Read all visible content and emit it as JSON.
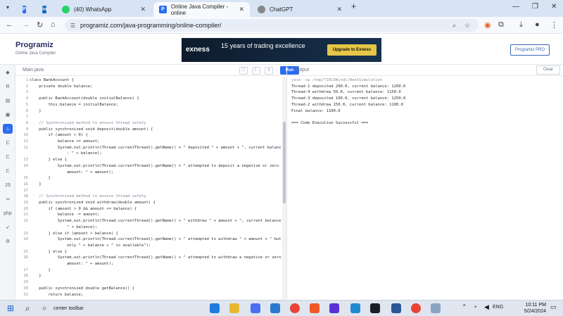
{
  "browser": {
    "tabs": [
      {
        "label": "",
        "icon": "programiz",
        "color": "#2b6cf0"
      },
      {
        "label": "",
        "icon": "linkedin",
        "color": "#0a66c2"
      },
      {
        "label": "(40) WhatsApp",
        "icon": "whatsapp",
        "color": "#25d366"
      },
      {
        "label": "Online Java Compiler - online",
        "icon": "programiz",
        "color": "#2b6cf0"
      },
      {
        "label": "ChatGPT",
        "icon": "chatgpt",
        "color": "#888888"
      }
    ],
    "url": "programiz.com/java-programming/online-compiler/"
  },
  "site": {
    "logo": "Programiz",
    "logo_sub": "Online Java Compiler",
    "pro_button": "Programiz PRO",
    "ad": {
      "brand": "exness",
      "headline": "15 years of trading excellence",
      "cta": "Upgrade to Exness"
    }
  },
  "editor": {
    "tab": "Main.java",
    "run_label": "Run",
    "lines": [
      {
        "n": "1",
        "t": "class BankAccount {"
      },
      {
        "n": "2",
        "t": "    private double balance;"
      },
      {
        "n": "3",
        "t": ""
      },
      {
        "n": "4",
        "t": "    public BankAccount(double initialBalance) {"
      },
      {
        "n": "5",
        "t": "        this.balance = initialBalance;"
      },
      {
        "n": "6",
        "t": "    }"
      },
      {
        "n": "7",
        "t": ""
      },
      {
        "n": "8",
        "t": "    // Synchronized method to ensure thread safety"
      },
      {
        "n": "9",
        "t": "    public synchronized void deposit(double amount) {"
      },
      {
        "n": "10",
        "t": "        if (amount > 0) {"
      },
      {
        "n": "11",
        "t": "            balance += amount;"
      },
      {
        "n": "12",
        "t": "            System.out.println(Thread.currentThread().getName() + \" deposited \" + amount + \", current balance"
      },
      {
        "n": "",
        "t": "                : \" + balance);"
      },
      {
        "n": "13",
        "t": "        } else {"
      },
      {
        "n": "14",
        "t": "            System.out.println(Thread.currentThread().getName() + \" attempted to deposit a negative or zero"
      },
      {
        "n": "",
        "t": "                amount: \" + amount);"
      },
      {
        "n": "15",
        "t": "        }"
      },
      {
        "n": "16",
        "t": "    }"
      },
      {
        "n": "17",
        "t": ""
      },
      {
        "n": "18",
        "t": "    // Synchronized method to ensure thread safety"
      },
      {
        "n": "19",
        "t": "    public synchronized void withdraw(double amount) {"
      },
      {
        "n": "20",
        "t": "        if (amount > 0 && amount <= balance) {"
      },
      {
        "n": "21",
        "t": "            balance -= amount;"
      },
      {
        "n": "22",
        "t": "            System.out.println(Thread.currentThread().getName() + \" withdrew \" + amount + \", current balance:"
      },
      {
        "n": "",
        "t": "                \" + balance);"
      },
      {
        "n": "23",
        "t": "        } else if (amount > balance) {"
      },
      {
        "n": "24",
        "t": "            System.out.println(Thread.currentThread().getName() + \" attempted to withdraw \" + amount + \" but"
      },
      {
        "n": "",
        "t": "                only \" + balance + \" is available\");"
      },
      {
        "n": "25",
        "t": "        } else {"
      },
      {
        "n": "26",
        "t": "            System.out.println(Thread.currentThread().getName() + \" attempted to withdraw a negative or zero"
      },
      {
        "n": "",
        "t": "                amount: \" + amount);"
      },
      {
        "n": "27",
        "t": "        }"
      },
      {
        "n": "28",
        "t": "    }"
      },
      {
        "n": "29",
        "t": ""
      },
      {
        "n": "30",
        "t": "    public synchronized double getBalance() {"
      },
      {
        "n": "31",
        "t": "        return balance;"
      }
    ]
  },
  "output": {
    "title": "Output",
    "clear_label": "Clear",
    "lines": [
      "java -cp /tmp/T1RCXWindc/BankSimulation",
      "Thread-1 deposited 200.0, current balance: 1200.0",
      "Thread-4 withdrew 50.0, current balance: 1150.0",
      "Thread-3 deposited 100.0, current balance: 1250.0",
      "Thread-2 withdrew 150.0, current balance: 1100.0",
      "Final balance: 1100.0",
      "",
      "=== Code Execution Successful ==="
    ]
  },
  "taskbar": {
    "search_text": "center toolbar",
    "lang": "ENG",
    "time": "10:11 PM",
    "date": "5/24/2024"
  }
}
